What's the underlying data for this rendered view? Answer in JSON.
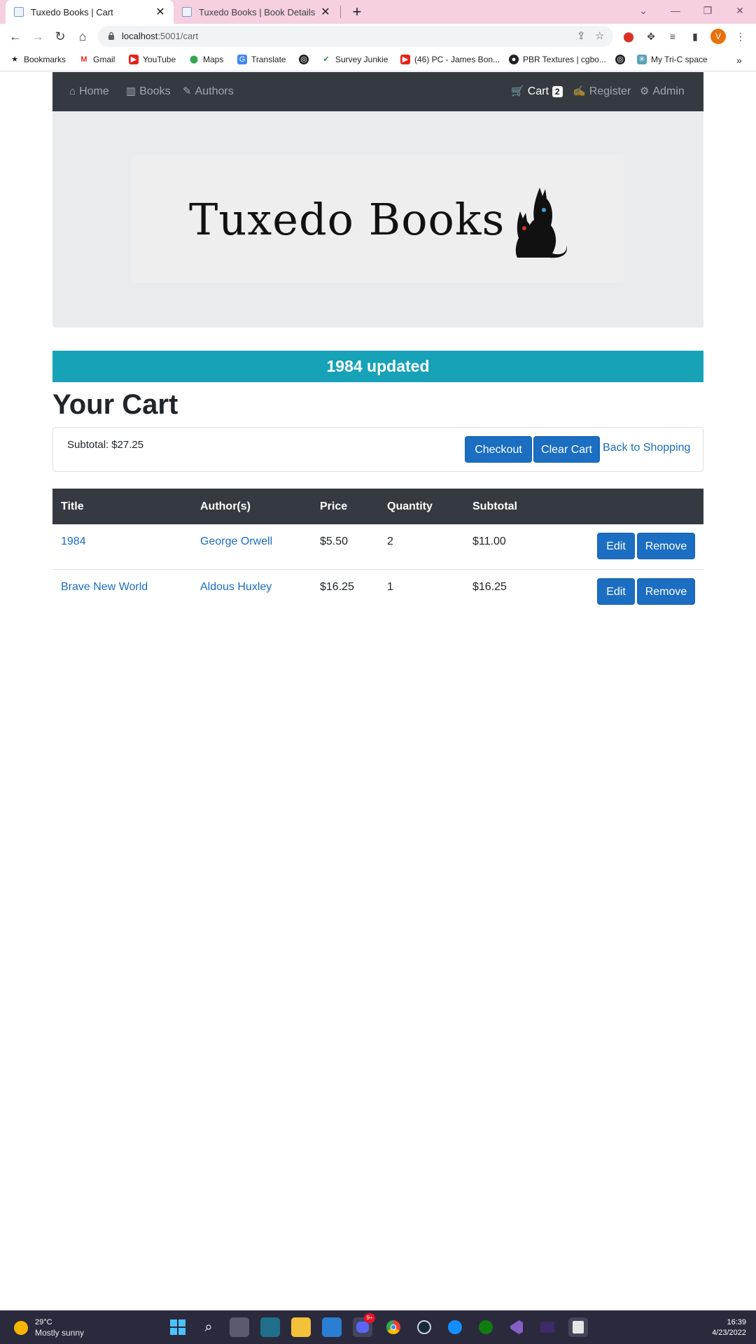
{
  "browser": {
    "tabs": [
      {
        "title": "Tuxedo Books | Cart",
        "active": true
      },
      {
        "title": "Tuxedo Books | Book Details",
        "active": false
      }
    ],
    "url_host": "localhost",
    "url_rest": ":5001/cart",
    "profile_initial": "V",
    "bookmarks": [
      "Bookmarks",
      "Gmail",
      "YouTube",
      "Maps",
      "Translate",
      "Survey Junkie",
      "(46) PC - James Bon...",
      "PBR Textures | cgbo...",
      "My Tri-C space"
    ]
  },
  "nav": {
    "home": "Home",
    "books": "Books",
    "authors": "Authors",
    "cart": "Cart",
    "cart_count": "2",
    "register": "Register",
    "admin": "Admin"
  },
  "logo": {
    "text": "Tuxedo Books"
  },
  "alert": {
    "message": "1984 updated"
  },
  "page": {
    "title": "Your Cart"
  },
  "summary": {
    "subtotal_label": "Subtotal:",
    "subtotal_value": "$27.25",
    "checkout": "Checkout",
    "clear_cart": "Clear Cart",
    "back": "Back to Shopping"
  },
  "table": {
    "headers": [
      "Title",
      "Author(s)",
      "Price",
      "Quantity",
      "Subtotal"
    ],
    "rows": [
      {
        "title": "1984",
        "author": "George Orwell",
        "price": "$5.50",
        "quantity": "2",
        "subtotal": "$11.00",
        "edit": "Edit",
        "remove": "Remove"
      },
      {
        "title": "Brave New World",
        "author": "Aldous Huxley",
        "price": "$16.25",
        "quantity": "1",
        "subtotal": "$16.25",
        "edit": "Edit",
        "remove": "Remove"
      }
    ]
  },
  "taskbar": {
    "temperature": "29°C",
    "weather": "Mostly sunny",
    "time": "16:39",
    "date": "4/23/2022",
    "notification_count": "9+"
  },
  "colors": {
    "primary": "#1b6ec2",
    "navbar": "#343a40",
    "alert": "#17a2b8",
    "tabbar": "#f6cfe0"
  }
}
